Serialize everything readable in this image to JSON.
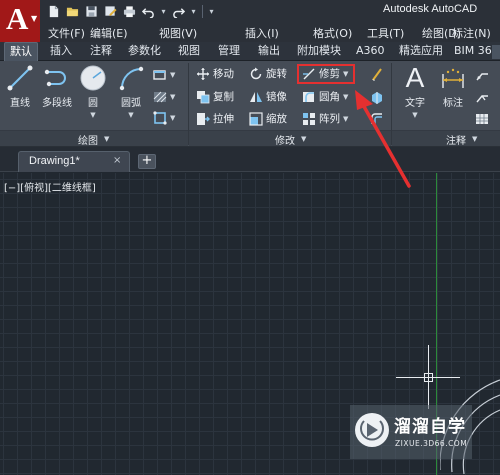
{
  "app": {
    "title": "Autodesk AutoCAD",
    "logo_letter": "A"
  },
  "quick_access": [
    "new-file-icon",
    "open-folder-icon",
    "save-icon",
    "save-as-icon",
    "print-icon",
    "undo-icon",
    "redo-icon"
  ],
  "menu": {
    "items": [
      "文件(F)",
      "编辑(E)",
      "视图(V)",
      "插入(I)",
      "格式(O)",
      "工具(T)",
      "绘图(D)",
      "标注(N)"
    ]
  },
  "ribbon_tabs": [
    "默认",
    "插入",
    "注释",
    "参数化",
    "视图",
    "管理",
    "输出",
    "附加模块",
    "A360",
    "精选应用",
    "BIM 36"
  ],
  "panels": {
    "draw": {
      "title": "绘图",
      "buttons": [
        "直线",
        "多段线",
        "圆",
        "圆弧"
      ]
    },
    "modify": {
      "title": "修改",
      "buttons": [
        "移动",
        "旋转",
        "修剪",
        "复制",
        "镜像",
        "圆角",
        "拉伸",
        "缩放",
        "阵列"
      ]
    },
    "annotation": {
      "title": "注释",
      "buttons": [
        "文字",
        "标注"
      ]
    }
  },
  "document": {
    "tab_name": "Drawing1*",
    "close": "×",
    "new_tab": "+"
  },
  "viewport": {
    "label": "[−][俯视][二维线框]"
  },
  "watermark": {
    "name": "溜溜自学",
    "url": "ZIXUE.3D66.COM"
  },
  "colors": {
    "highlight": "#e53030",
    "logo": "#a11818",
    "y_axis": "#2c8a3a"
  }
}
